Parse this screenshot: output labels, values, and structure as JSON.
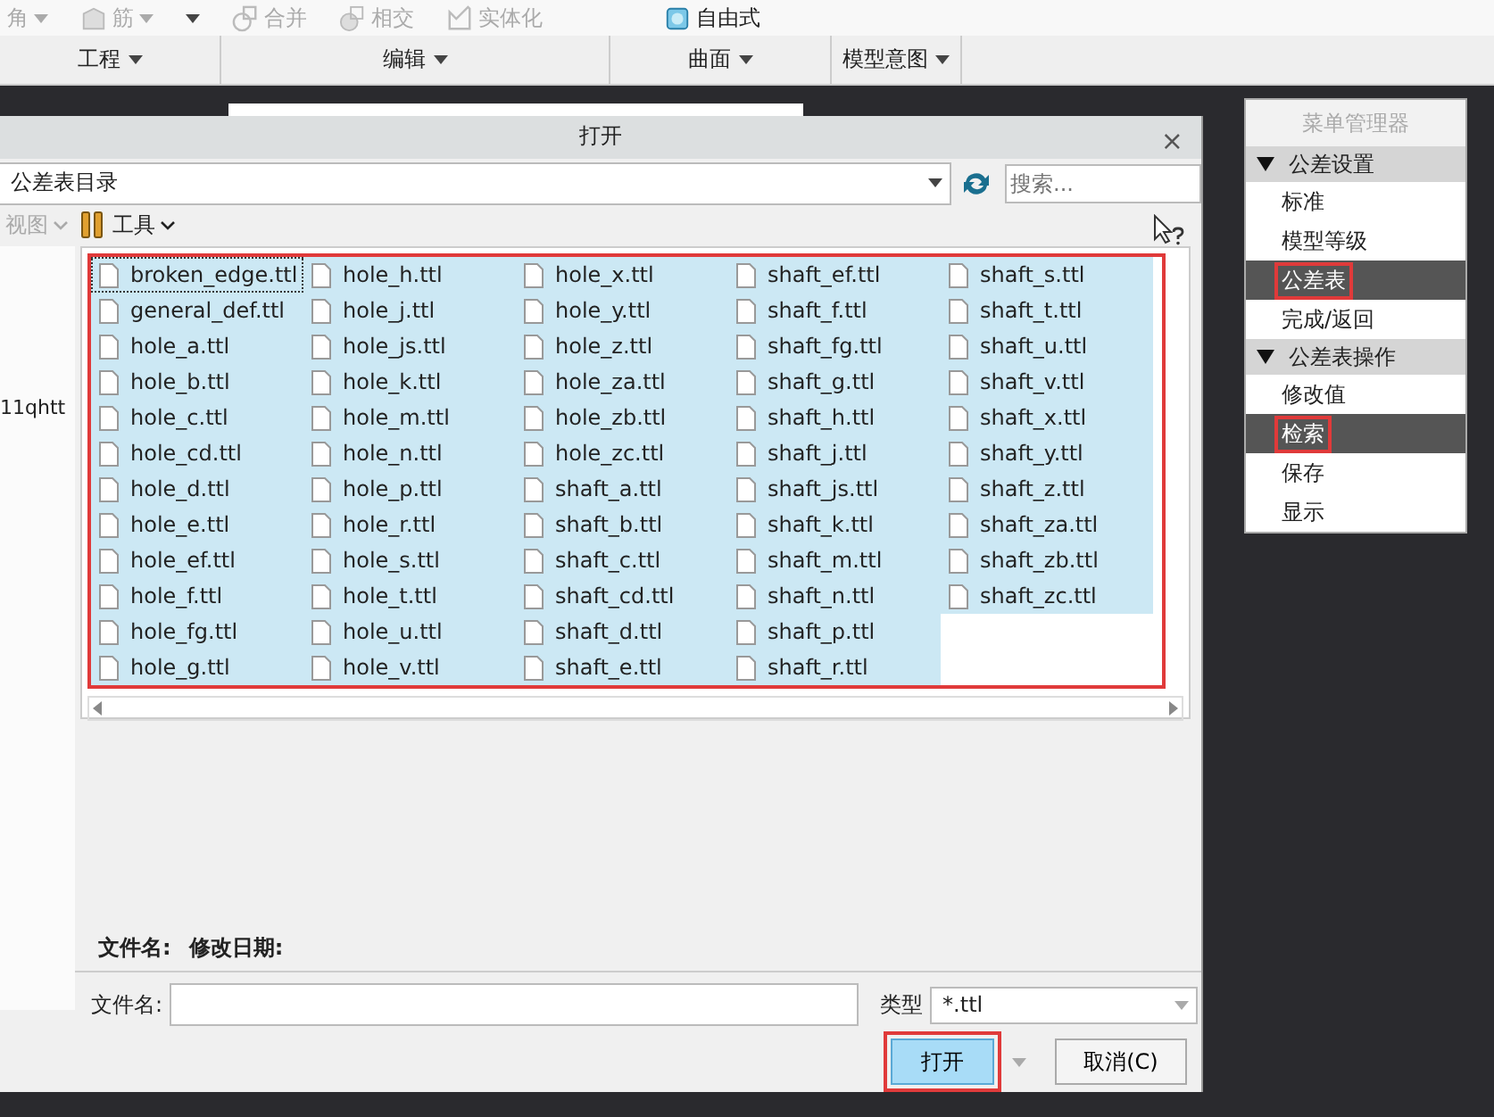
{
  "ribbon": {
    "tools": [
      {
        "label": "角",
        "kind": "chamfer",
        "disabled": true
      },
      {
        "label": "筋",
        "kind": "rib",
        "disabled": true
      },
      {
        "kind": "dropdown"
      },
      {
        "label": "合并",
        "kind": "merge",
        "disabled": true
      },
      {
        "label": "相交",
        "kind": "intersect",
        "disabled": true
      },
      {
        "label": "实体化",
        "kind": "solidify",
        "disabled": true
      },
      {
        "label": "自由式",
        "kind": "freestyle",
        "disabled": false
      }
    ],
    "groups": [
      {
        "label": "工程"
      },
      {
        "label": "编辑"
      },
      {
        "label": "曲面"
      },
      {
        "label": "模型意图"
      }
    ]
  },
  "dialog": {
    "title": "打开",
    "close": "×",
    "location": {
      "value": "公差表目录"
    },
    "search": {
      "placeholder": "搜索..."
    },
    "toolbar": [
      {
        "label": "视图",
        "disabled": true
      },
      {
        "label": "工具",
        "disabled": false
      }
    ],
    "side_pane_text": "11qhtt",
    "file_list": {
      "annotated": true,
      "files": [
        {
          "name": "broken_edge.ttl",
          "selected": true,
          "focused": true
        },
        {
          "name": "general_def.ttl",
          "selected": true,
          "focused": false
        },
        {
          "name": "hole_a.ttl",
          "selected": true,
          "focused": false
        },
        {
          "name": "hole_b.ttl",
          "selected": true,
          "focused": false
        },
        {
          "name": "hole_c.ttl",
          "selected": true,
          "focused": false
        },
        {
          "name": "hole_cd.ttl",
          "selected": true,
          "focused": false
        },
        {
          "name": "hole_d.ttl",
          "selected": true,
          "focused": false
        },
        {
          "name": "hole_e.ttl",
          "selected": true,
          "focused": false
        },
        {
          "name": "hole_ef.ttl",
          "selected": true,
          "focused": false
        },
        {
          "name": "hole_f.ttl",
          "selected": true,
          "focused": false
        },
        {
          "name": "hole_fg.ttl",
          "selected": true,
          "focused": false
        },
        {
          "name": "hole_g.ttl",
          "selected": true,
          "focused": false
        },
        {
          "name": "hole_h.ttl",
          "selected": true,
          "focused": false
        },
        {
          "name": "hole_j.ttl",
          "selected": true,
          "focused": false
        },
        {
          "name": "hole_js.ttl",
          "selected": true,
          "focused": false
        },
        {
          "name": "hole_k.ttl",
          "selected": true,
          "focused": false
        },
        {
          "name": "hole_m.ttl",
          "selected": true,
          "focused": false
        },
        {
          "name": "hole_n.ttl",
          "selected": true,
          "focused": false
        },
        {
          "name": "hole_p.ttl",
          "selected": true,
          "focused": false
        },
        {
          "name": "hole_r.ttl",
          "selected": true,
          "focused": false
        },
        {
          "name": "hole_s.ttl",
          "selected": true,
          "focused": false
        },
        {
          "name": "hole_t.ttl",
          "selected": true,
          "focused": false
        },
        {
          "name": "hole_u.ttl",
          "selected": true,
          "focused": false
        },
        {
          "name": "hole_v.ttl",
          "selected": true,
          "focused": false
        },
        {
          "name": "hole_x.ttl",
          "selected": true,
          "focused": false
        },
        {
          "name": "hole_y.ttl",
          "selected": true,
          "focused": false
        },
        {
          "name": "hole_z.ttl",
          "selected": true,
          "focused": false
        },
        {
          "name": "hole_za.ttl",
          "selected": true,
          "focused": false
        },
        {
          "name": "hole_zb.ttl",
          "selected": true,
          "focused": false
        },
        {
          "name": "hole_zc.ttl",
          "selected": true,
          "focused": false
        },
        {
          "name": "shaft_a.ttl",
          "selected": true,
          "focused": false
        },
        {
          "name": "shaft_b.ttl",
          "selected": true,
          "focused": false
        },
        {
          "name": "shaft_c.ttl",
          "selected": true,
          "focused": false
        },
        {
          "name": "shaft_cd.ttl",
          "selected": true,
          "focused": false
        },
        {
          "name": "shaft_d.ttl",
          "selected": true,
          "focused": false
        },
        {
          "name": "shaft_e.ttl",
          "selected": true,
          "focused": false
        },
        {
          "name": "shaft_ef.ttl",
          "selected": true,
          "focused": false
        },
        {
          "name": "shaft_f.ttl",
          "selected": true,
          "focused": false
        },
        {
          "name": "shaft_fg.ttl",
          "selected": true,
          "focused": false
        },
        {
          "name": "shaft_g.ttl",
          "selected": true,
          "focused": false
        },
        {
          "name": "shaft_h.ttl",
          "selected": true,
          "focused": false
        },
        {
          "name": "shaft_j.ttl",
          "selected": true,
          "focused": false
        },
        {
          "name": "shaft_js.ttl",
          "selected": true,
          "focused": false
        },
        {
          "name": "shaft_k.ttl",
          "selected": true,
          "focused": false
        },
        {
          "name": "shaft_m.ttl",
          "selected": true,
          "focused": false
        },
        {
          "name": "shaft_n.ttl",
          "selected": true,
          "focused": false
        },
        {
          "name": "shaft_p.ttl",
          "selected": true,
          "focused": false
        },
        {
          "name": "shaft_r.ttl",
          "selected": true,
          "focused": false
        },
        {
          "name": "shaft_s.ttl",
          "selected": true,
          "focused": false
        },
        {
          "name": "shaft_t.ttl",
          "selected": true,
          "focused": false
        },
        {
          "name": "shaft_u.ttl",
          "selected": true,
          "focused": false
        },
        {
          "name": "shaft_v.ttl",
          "selected": true,
          "focused": false
        },
        {
          "name": "shaft_x.ttl",
          "selected": true,
          "focused": false
        },
        {
          "name": "shaft_y.ttl",
          "selected": true,
          "focused": false
        },
        {
          "name": "shaft_z.ttl",
          "selected": true,
          "focused": false
        },
        {
          "name": "shaft_za.ttl",
          "selected": true,
          "focused": false
        },
        {
          "name": "shaft_zb.ttl",
          "selected": true,
          "focused": false
        },
        {
          "name": "shaft_zc.ttl",
          "selected": true,
          "focused": false
        }
      ]
    },
    "details_header": [
      "文件名:",
      "修改日期:"
    ],
    "filename": {
      "label": "文件名:"
    },
    "type": {
      "label": "类型",
      "value": "*.ttl"
    },
    "buttons": [
      {
        "label": "打开",
        "primary": true,
        "annotated": true
      },
      {
        "label": "取消(C)",
        "primary": false,
        "annotated": false
      }
    ]
  },
  "menu_manager": {
    "title": "菜单管理器",
    "sections": [
      {
        "label": "公差设置",
        "expanded": true,
        "items": [
          {
            "label": "标准",
            "selected": false,
            "annotated": false
          },
          {
            "label": "模型等级",
            "selected": false,
            "annotated": false
          },
          {
            "label": "公差表",
            "selected": true,
            "annotated": true
          },
          {
            "label": "完成/返回",
            "selected": false,
            "annotated": false
          }
        ]
      },
      {
        "label": "公差表操作",
        "expanded": true,
        "items": [
          {
            "label": "修改值",
            "selected": false,
            "annotated": false
          },
          {
            "label": "检索",
            "selected": true,
            "annotated": true
          },
          {
            "label": "保存",
            "selected": false,
            "annotated": false
          },
          {
            "label": "显示",
            "selected": false,
            "annotated": false
          }
        ]
      }
    ]
  }
}
